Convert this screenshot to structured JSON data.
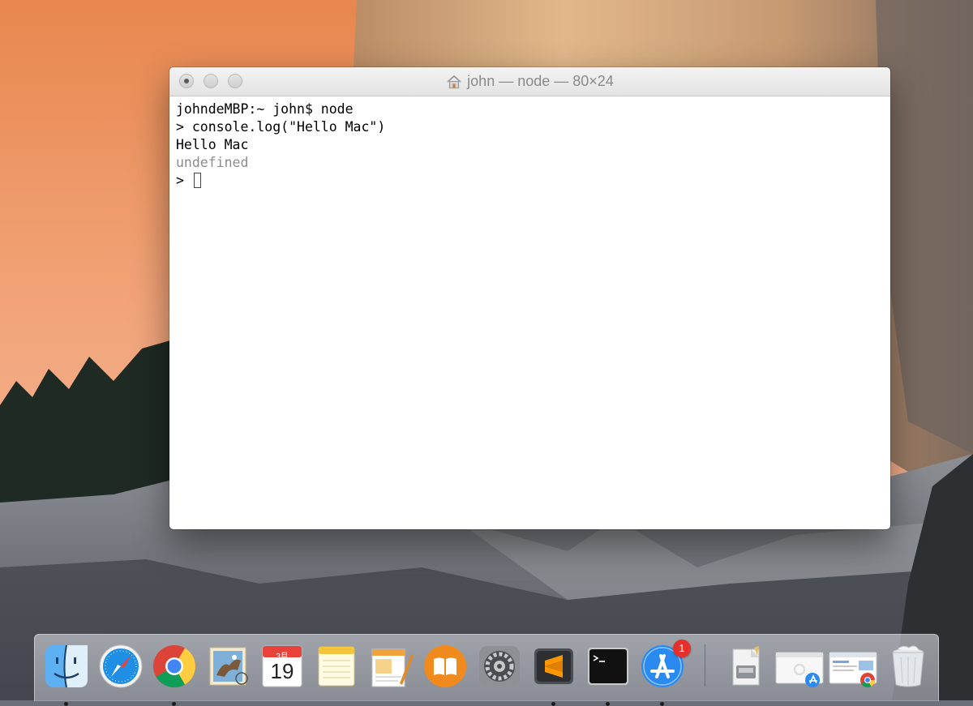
{
  "window": {
    "title": "john — node — 80×24"
  },
  "terminal": {
    "lines": [
      "johndeMBP:~ john$ node",
      "> console.log(\"Hello Mac\")",
      "Hello Mac",
      "undefined",
      "> "
    ]
  },
  "dock": {
    "calendar": {
      "month": "3月",
      "day": "19"
    },
    "app_store_badge": "1",
    "items": [
      "finder-icon",
      "safari-icon",
      "chrome-icon",
      "mail-icon",
      "calendar-icon",
      "notes-icon",
      "pages-icon",
      "ibooks-icon",
      "system-preferences-icon",
      "sublime-text-icon",
      "terminal-icon",
      "app-store-icon",
      "disk-utility-icon",
      "app-store-window-icon",
      "chrome-window-icon",
      "trash-icon"
    ]
  },
  "colors": {
    "badge": "#e5302b",
    "terminal_text": "#000000",
    "terminal_muted": "#8c8c8c"
  }
}
